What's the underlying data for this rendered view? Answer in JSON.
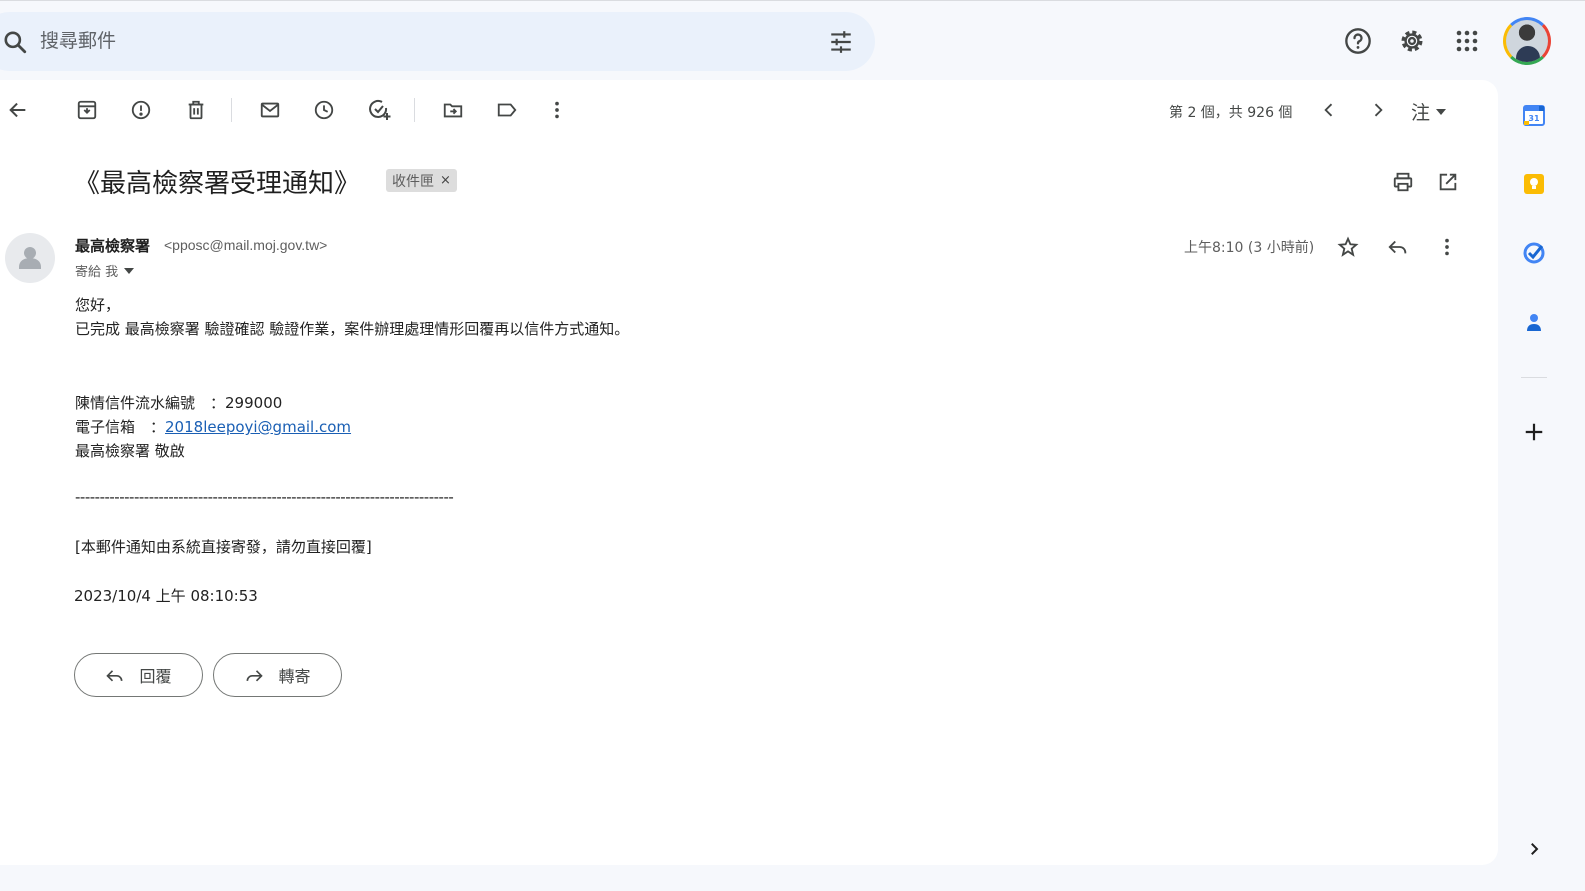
{
  "search": {
    "placeholder": "搜尋郵件"
  },
  "toolbar": {
    "counter": "第 2 個，共 926 個",
    "lang_label": "注"
  },
  "email": {
    "subject": "《最高檢察署受理通知》",
    "label": "收件匣",
    "label_close": "×",
    "sender_name": "最高檢察署",
    "sender_email": "<pposc@mail.moj.gov.tw>",
    "to_line": "寄給 我",
    "time": "上午8:10 (3 小時前)",
    "greeting": "您好，",
    "line1": "已完成 最高檢察署 驗證確認 驗證作業，案件辦理處理情形回覆再以信件方式通知。",
    "serial_label": "陳情信件流水編號　：",
    "serial_value": "299000",
    "email_label": "電子信箱　：",
    "email_value": "2018leepoyi@gmail.com",
    "signature": "最高檢察署 敬啟",
    "divider": "-----------------------------------------------------------------------------",
    "notice": "[本郵件通知由系統直接寄發，請勿直接回覆]",
    "datetime": "2023/10/4 上午 08:10:53"
  },
  "actions": {
    "reply": "回覆",
    "forward": "轉寄"
  },
  "colors": {
    "background": "#f6f8fc",
    "search_bg": "#eaf1fb",
    "link": "#1a5fb4"
  }
}
